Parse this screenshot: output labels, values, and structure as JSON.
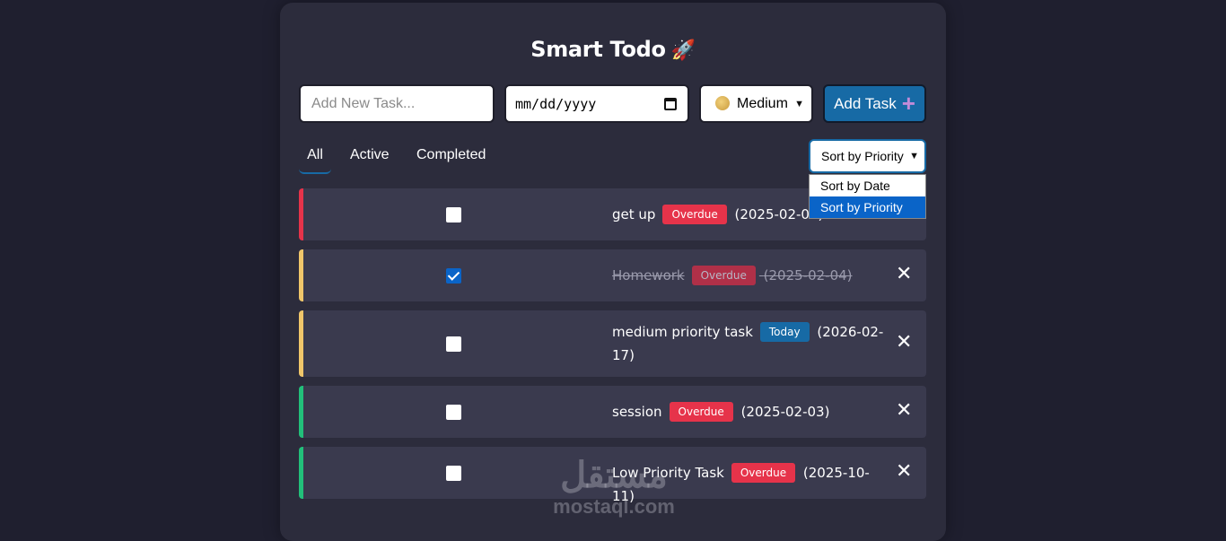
{
  "app": {
    "title": "Smart Todo",
    "title_emoji": "🚀"
  },
  "form": {
    "task_placeholder": "Add New Task...",
    "task_value": "",
    "date_placeholder": "mm/dd/yyyy",
    "priority_selected": "Medium",
    "priority_icon": "moon-icon",
    "add_button_label": "Add Task",
    "add_button_icon": "+"
  },
  "filters": {
    "tabs": [
      {
        "label": "All",
        "active": true
      },
      {
        "label": "Active",
        "active": false
      },
      {
        "label": "Completed",
        "active": false
      }
    ]
  },
  "sort": {
    "selected": "Sort by Priority",
    "options": [
      "Sort by Date",
      "Sort by Priority"
    ],
    "highlighted": "Sort by Priority"
  },
  "tasks": [
    {
      "name": "get up",
      "badge": "Overdue",
      "date": "(2025-02-02)",
      "completed": false,
      "priority_color": "#e6334a"
    },
    {
      "name": "Homework",
      "badge": "Overdue",
      "date": "(2025-02-04)",
      "completed": true,
      "priority_color": "#f0c66a"
    },
    {
      "name": "medium priority task",
      "badge": "Today",
      "date": "(2026-02-17)",
      "completed": false,
      "priority_color": "#f0c66a"
    },
    {
      "name": "session",
      "badge": "Overdue",
      "date": "(2025-02-03)",
      "completed": false,
      "priority_color": "#22c07a"
    },
    {
      "name": "Low Priority Task",
      "badge": "Overdue",
      "date": "(2025-10-11)",
      "completed": false,
      "priority_color": "#22c07a"
    }
  ],
  "delete_icon": "✕",
  "watermark": {
    "arabic": "مستقل",
    "latin": "mostaql.com"
  },
  "colors": {
    "background": "#1f1f2f",
    "card": "#2c2c3c",
    "row": "#3a3a4e",
    "accent": "#176aa5",
    "overdue": "#e6334a"
  }
}
